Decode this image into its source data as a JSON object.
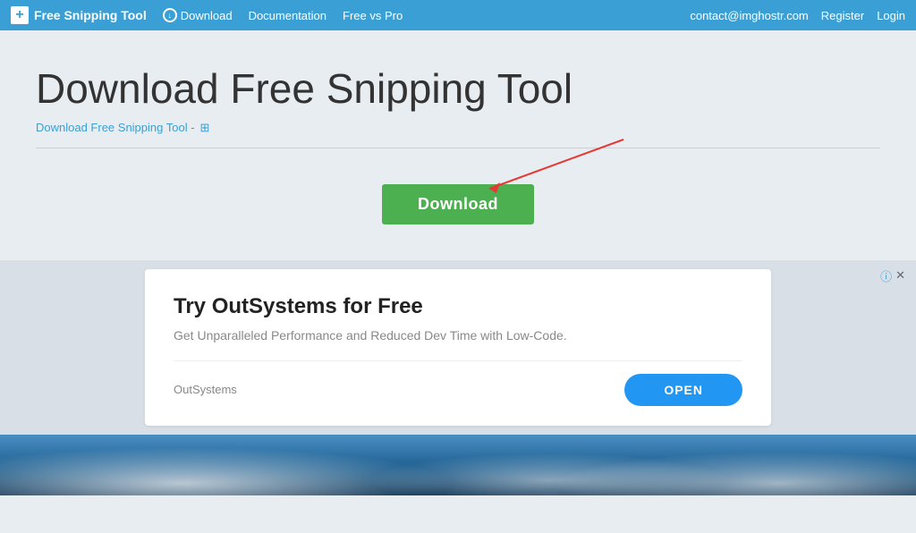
{
  "navbar": {
    "brand": "Free Snipping Tool",
    "brand_icon": "+",
    "download_label": "Download",
    "documentation_label": "Documentation",
    "free_vs_pro_label": "Free vs Pro",
    "contact_email": "contact@imghostr.com",
    "register_label": "Register",
    "login_label": "Login"
  },
  "main": {
    "page_title": "Download Free Snipping Tool",
    "subtitle_link": "Download Free Snipping Tool -",
    "divider": true
  },
  "download_section": {
    "button_label": "Download"
  },
  "ad": {
    "info_icon": "ⓘ",
    "close_icon": "✕",
    "title": "Try OutSystems for Free",
    "subtitle": "Get Unparalleled Performance and Reduced Dev Time with Low-Code.",
    "brand": "OutSystems",
    "open_label": "OPEN"
  }
}
